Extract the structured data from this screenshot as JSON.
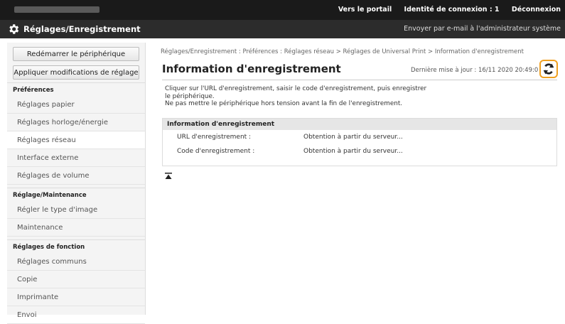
{
  "topbar": {
    "portal_link": "Vers le portail",
    "login_identity": "Identité de connexion : 1",
    "logout_link": "Déconnexion"
  },
  "titlebar": {
    "title": "Réglages/Enregistrement",
    "email_admin": "Envoyer par e-mail à l'administrateur système"
  },
  "sidebar": {
    "restart_button": "Redémarrer le périphérique",
    "apply_button": "Appliquer modifications de réglage",
    "sections": [
      {
        "label": "Préférences",
        "items": [
          "Réglages papier",
          "Réglages horloge/énergie",
          "Réglages réseau",
          "Interface externe",
          "Réglages de volume"
        ]
      },
      {
        "label": "Réglage/Maintenance",
        "items": [
          "Régler le type d'image",
          "Maintenance"
        ]
      },
      {
        "label": "Réglages de fonction",
        "items": [
          "Réglages communs",
          "Copie",
          "Imprimante",
          "Envoi"
        ]
      }
    ]
  },
  "main": {
    "breadcrumb": "Réglages/Enregistrement : Préférences : Réglages réseau > Réglages de Universal Print > Information d'enregistrement",
    "title": "Information d'enregistrement",
    "last_update": "Dernière mise à jour : 16/11 2020 20:49:0",
    "description_lines": [
      "Cliquer sur l'URL d'enregistrement, saisir le code d'enregistrement, puis enregistrer",
      "le périphérique.",
      "Ne pas mettre le périphérique hors tension avant la fin de l'enregistrement."
    ],
    "panel_title": "Information d'enregistrement",
    "rows": [
      {
        "label": "URL d'enregistrement :",
        "value": "Obtention à partir du serveur..."
      },
      {
        "label": "Code d'enregistrement :",
        "value": "Obtention à partir du serveur..."
      }
    ]
  },
  "icons": {
    "settings": "gear-icon",
    "refresh": "refresh-icon",
    "to_top": "back-to-top-icon"
  },
  "colors": {
    "topbar": "#1a1a1a",
    "titlebar": "#2c2c2c",
    "highlight": "#f0a020"
  }
}
